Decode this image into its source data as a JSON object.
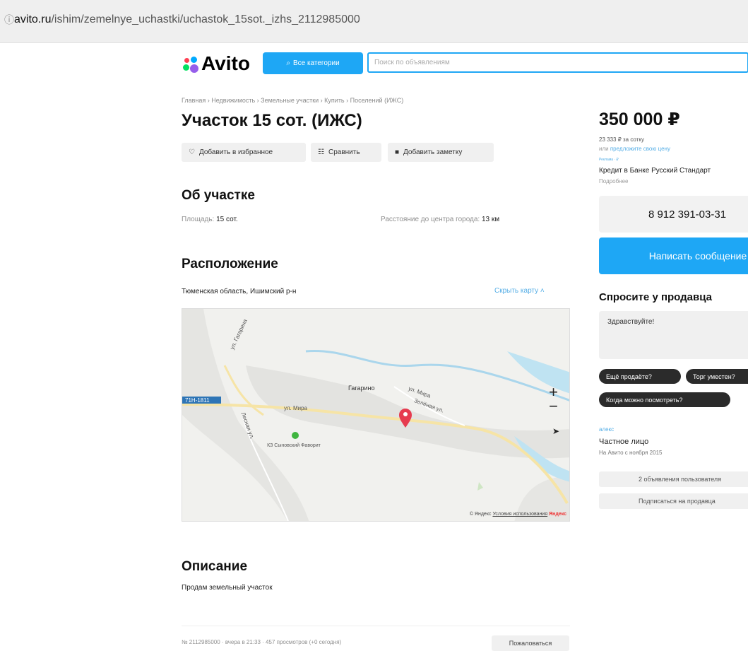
{
  "browser": {
    "url_host": "avito.ru",
    "url_path": "/ishim/zemelnye_uchastki/uchastok_15sot._izhs_2112985000"
  },
  "header": {
    "logo": "Avito",
    "categories_button": "Все категории",
    "search_placeholder": "Поиск по объявлениям"
  },
  "breadcrumbs": "Главная › Недвижимость › Земельные участки › Купить › Поселений (ИЖС)",
  "title": "Участок 15 сот. (ИЖС)",
  "actions": {
    "favorite": "Добавить в избранное",
    "compare": "Сравнить",
    "note": "Добавить заметку"
  },
  "about": {
    "heading": "Об участке",
    "area_label": "Площадь:",
    "area_value": "15 сот.",
    "distance_label": "Расстояние до центра города:",
    "distance_value": "13 км"
  },
  "location": {
    "heading": "Расположение",
    "address": "Тюменская область, Ишимский р-н",
    "hide_map": "Скрыть карту ˄"
  },
  "map": {
    "labels": {
      "gagarino": "Гагарино",
      "street_gagarina": "ул. Гагарина",
      "street_mira": "ул. Мира",
      "road_code": "71Н-1811",
      "sovkhoz": "КЗ Сыновский Фаворит",
      "street_mira_2": "ул. Мира",
      "street_zelenaya": "Зелёная ул.",
      "street_lesnaya": "Лесная ул."
    },
    "zoom_in": "+",
    "zoom_out": "−",
    "copyright_prefix": "© Яндекс",
    "terms": "Условия использования",
    "brand": "Яндекс"
  },
  "description": {
    "heading": "Описание",
    "text": "Продам земельный участок"
  },
  "footer": {
    "meta": "№ 2112985000 · вчера в 21:33 · 457 просмотров (+0 сегодня)",
    "complain": "Пожаловаться"
  },
  "sidebar": {
    "price": "350 000 ₽",
    "price_per_sotka": "23 333 ₽ за сотку",
    "offer_prefix": "или",
    "offer_link": "предложите свою цену",
    "ad_tag": "Реклама · ₽",
    "credit": "Кредит в Банке Русский Стандарт",
    "more": "Подробнее",
    "phone": "8 912 391-03-31",
    "message_button": "Написать сообщение",
    "ask_heading": "Спросите у продавца",
    "ask_placeholder": "Здравствуйте!",
    "chips": [
      "Ещё продаёте?",
      "Торг уместен?",
      "Когда можно посмотреть?"
    ],
    "seller_name": "алекс",
    "seller_type": "Частное лицо",
    "seller_since": "На Авито с ноября 2015",
    "user_ads": "2 объявления пользователя",
    "subscribe": "Подписаться на продавца"
  },
  "colors": {
    "accent": "#1ea7f5",
    "link": "#55aee6",
    "pin": "#e63b4f"
  }
}
